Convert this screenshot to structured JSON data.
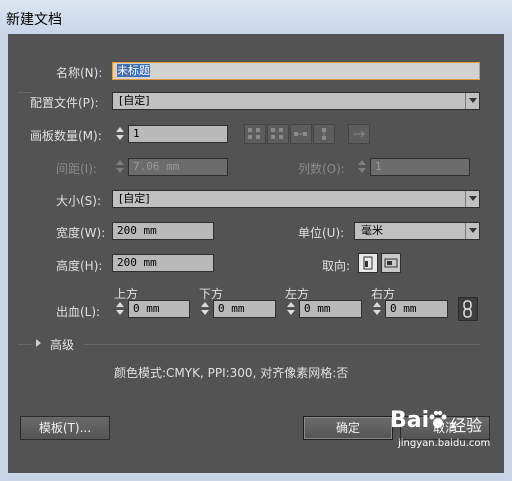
{
  "window": {
    "title": "新建文档"
  },
  "name": {
    "label": "名称(N):",
    "value": "未标题"
  },
  "profile": {
    "label": "配置文件(P):",
    "value": "[自定]"
  },
  "artboards": {
    "label": "画板数量(M):",
    "value": "1"
  },
  "spacing": {
    "label": "间距(I):",
    "value": "7.06 mm"
  },
  "columns": {
    "label": "列数(O):",
    "value": "1"
  },
  "size": {
    "label": "大小(S):",
    "value": "[自定]"
  },
  "width": {
    "label": "宽度(W):",
    "value": "200 mm"
  },
  "units": {
    "label": "单位(U):",
    "value": "毫米"
  },
  "height": {
    "label": "高度(H):",
    "value": "200 mm"
  },
  "orientation": {
    "label": "取向:"
  },
  "bleed": {
    "label": "出血(L):",
    "top_label": "上方",
    "top_value": "0 mm",
    "bottom_label": "下方",
    "bottom_value": "0 mm",
    "left_label": "左方",
    "left_value": "0 mm",
    "right_label": "右方",
    "right_value": "0 mm"
  },
  "advanced": {
    "label": "高级"
  },
  "info": {
    "text": "颜色模式:CMYK, PPI:300, 对齐像素网格:否"
  },
  "buttons": {
    "templates": "模板(T)...",
    "ok": "确定",
    "cancel": "取消"
  },
  "watermark": {
    "brand": "Bai",
    "brand2": "经验",
    "url": "jingyan.baidu.com"
  }
}
